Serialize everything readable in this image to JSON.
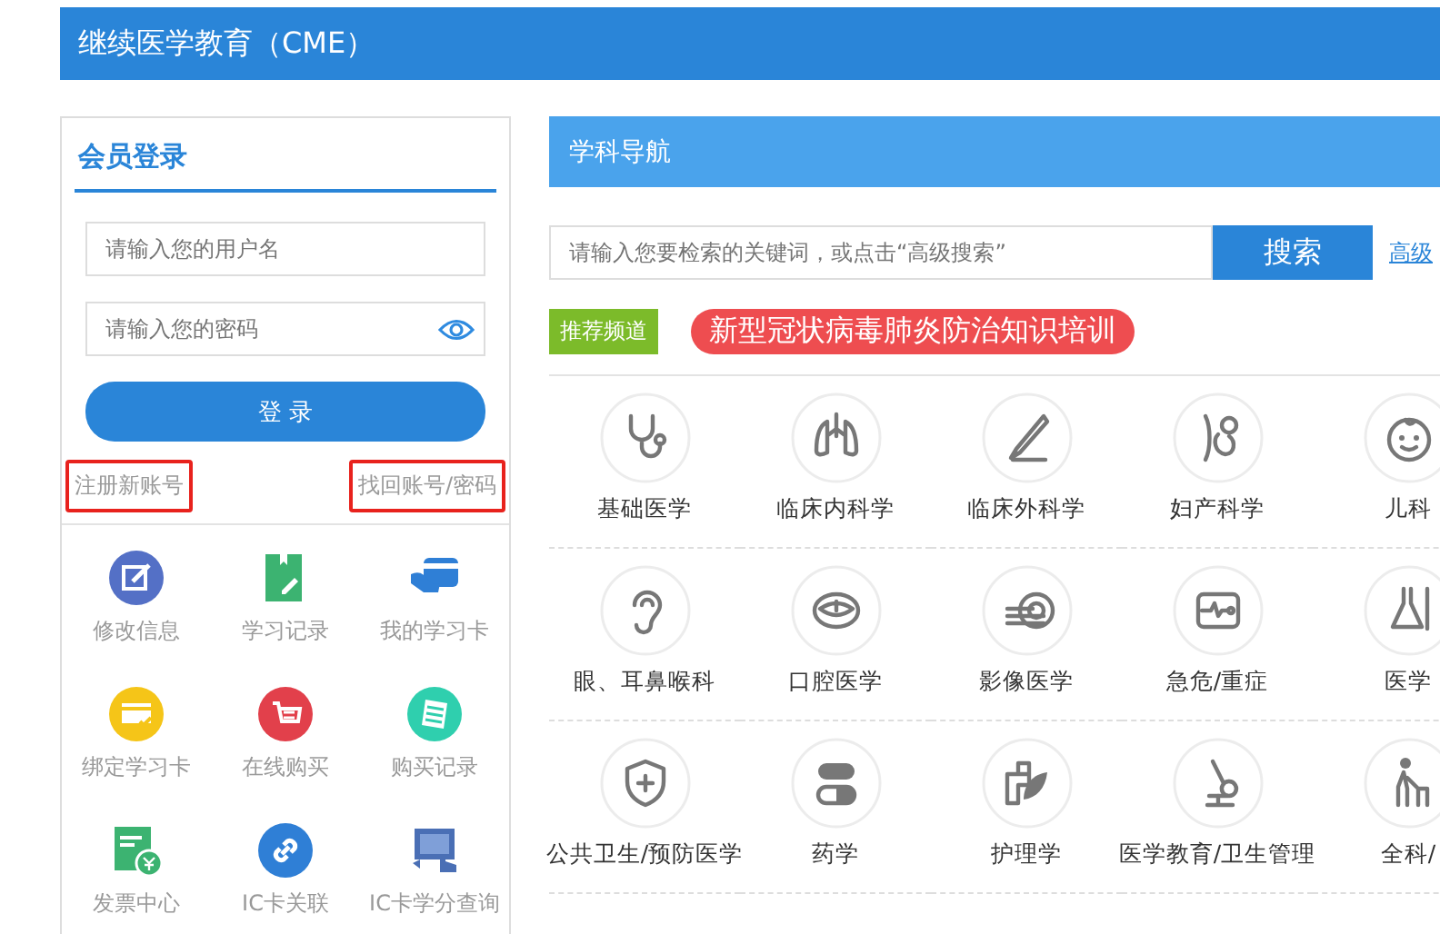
{
  "header": {
    "title": "继续医学教育（CME）"
  },
  "login": {
    "title": "会员登录",
    "username": {
      "placeholder": "请输入您的用户名"
    },
    "password": {
      "placeholder": "请输入您的密码"
    },
    "submit": "登 录",
    "register_link": "注册新账号",
    "recover_link": "找回账号/密码"
  },
  "member_menu": [
    {
      "label": "修改信息"
    },
    {
      "label": "学习记录"
    },
    {
      "label": "我的学习卡"
    },
    {
      "label": "绑定学习卡"
    },
    {
      "label": "在线购买"
    },
    {
      "label": "购买记录"
    },
    {
      "label": "发票中心"
    },
    {
      "label": "IC卡关联"
    },
    {
      "label": "IC卡学分查询"
    }
  ],
  "subject_nav": {
    "title": "学科导航",
    "search": {
      "placeholder": "请输入您要检索的关键词，或点击“高级搜索”",
      "button": "搜索",
      "advanced_link": "高级"
    },
    "recommend": {
      "tag": "推荐频道",
      "banner": "新型冠状病毒肺炎防治知识培训"
    },
    "categories": [
      {
        "label": "基础医学"
      },
      {
        "label": "临床内科学"
      },
      {
        "label": "临床外科学"
      },
      {
        "label": "妇产科学"
      },
      {
        "label": "儿科"
      },
      {
        "label": "眼、耳鼻喉科"
      },
      {
        "label": "口腔医学"
      },
      {
        "label": "影像医学"
      },
      {
        "label": "急危/重症"
      },
      {
        "label": "医学"
      },
      {
        "label": "公共卫生/预防医学"
      },
      {
        "label": "药学"
      },
      {
        "label": "护理学"
      },
      {
        "label": "医学教育/卫生管理"
      },
      {
        "label": "全科/"
      }
    ]
  }
}
